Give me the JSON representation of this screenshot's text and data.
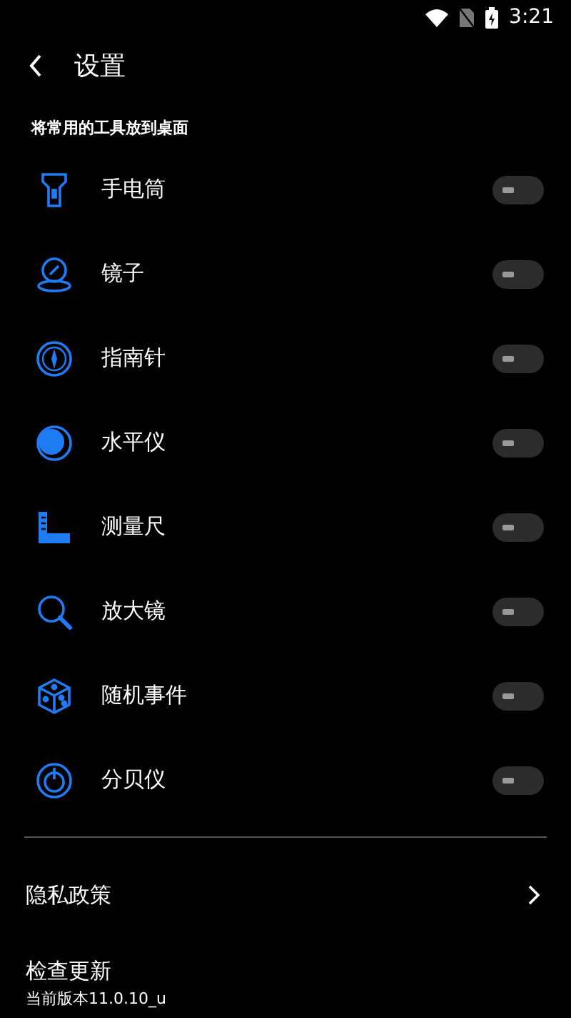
{
  "status_bar": {
    "time": "3:21"
  },
  "header": {
    "title": "设置"
  },
  "section": {
    "title": "将常用的工具放到桌面",
    "items": [
      {
        "label": "手电筒",
        "on": false
      },
      {
        "label": "镜子",
        "on": false
      },
      {
        "label": "指南针",
        "on": false
      },
      {
        "label": "水平仪",
        "on": false
      },
      {
        "label": "测量尺",
        "on": false
      },
      {
        "label": "放大镜",
        "on": false
      },
      {
        "label": "随机事件",
        "on": false
      },
      {
        "label": "分贝仪",
        "on": false
      }
    ]
  },
  "privacy": {
    "label": "隐私政策"
  },
  "update": {
    "label": "检查更新",
    "version": "当前版本11.0.10_u"
  }
}
